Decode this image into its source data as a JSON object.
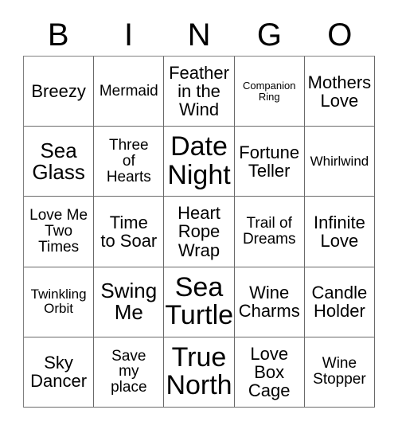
{
  "card": {
    "title_letters": [
      "B",
      "I",
      "N",
      "G",
      "O"
    ],
    "columns": 5,
    "rows": 5,
    "border_color": "#6a6a6a",
    "background_color": "#ffffff",
    "text_color": "#000000"
  },
  "grid": [
    [
      {
        "text": "Breezy",
        "size": "l"
      },
      {
        "text": "Mermaid",
        "size": "m"
      },
      {
        "text": "Feather\nin the\nWind",
        "size": "l"
      },
      {
        "text": "Companion\nRing",
        "size": "xs"
      },
      {
        "text": "Mothers\nLove",
        "size": "l"
      }
    ],
    [
      {
        "text": "Sea\nGlass",
        "size": "xl"
      },
      {
        "text": "Three\nof\nHearts",
        "size": "m"
      },
      {
        "text": "Date\nNight",
        "size": "xxl"
      },
      {
        "text": "Fortune\nTeller",
        "size": "l"
      },
      {
        "text": "Whirlwind",
        "size": "s"
      }
    ],
    [
      {
        "text": "Love Me\nTwo\nTimes",
        "size": "m"
      },
      {
        "text": "Time\nto Soar",
        "size": "l"
      },
      {
        "text": "Heart\nRope\nWrap",
        "size": "l"
      },
      {
        "text": "Trail of\nDreams",
        "size": "m"
      },
      {
        "text": "Infinite\nLove",
        "size": "l"
      }
    ],
    [
      {
        "text": "Twinkling\nOrbit",
        "size": "s"
      },
      {
        "text": "Swing\nMe",
        "size": "xl"
      },
      {
        "text": "Sea\nTurtle",
        "size": "xxl"
      },
      {
        "text": "Wine\nCharms",
        "size": "l"
      },
      {
        "text": "Candle\nHolder",
        "size": "l"
      }
    ],
    [
      {
        "text": "Sky\nDancer",
        "size": "l"
      },
      {
        "text": "Save\nmy\nplace",
        "size": "m"
      },
      {
        "text": "True\nNorth",
        "size": "xxl"
      },
      {
        "text": "Love\nBox\nCage",
        "size": "l"
      },
      {
        "text": "Wine\nStopper",
        "size": "m"
      }
    ]
  ]
}
